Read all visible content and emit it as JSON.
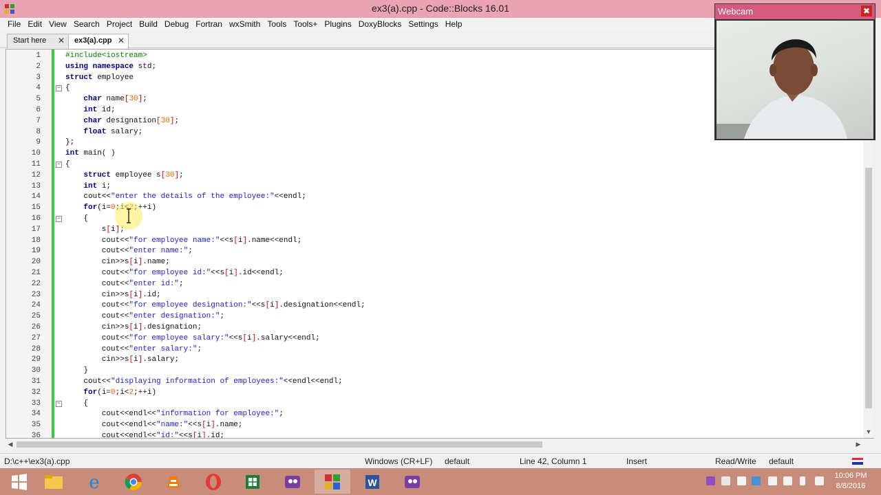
{
  "window": {
    "title": "ex3(a).cpp - Code::Blocks 16.01"
  },
  "menu": [
    "File",
    "Edit",
    "View",
    "Search",
    "Project",
    "Build",
    "Debug",
    "Fortran",
    "wxSmith",
    "Tools",
    "Tools+",
    "Plugins",
    "DoxyBlocks",
    "Settings",
    "Help"
  ],
  "tabs": [
    {
      "label": "Start here",
      "active": false
    },
    {
      "label": "ex3(a).cpp",
      "active": true
    }
  ],
  "editor": {
    "lines": [
      {
        "n": "1",
        "text": "#include<iostream>"
      },
      {
        "n": "2",
        "text": "using namespace std;"
      },
      {
        "n": "3",
        "text": "struct employee"
      },
      {
        "n": "4",
        "text": "{"
      },
      {
        "n": "5",
        "text": "    char name[30];"
      },
      {
        "n": "6",
        "text": "    int id;"
      },
      {
        "n": "7",
        "text": "    char designation[30];"
      },
      {
        "n": "8",
        "text": "    float salary;"
      },
      {
        "n": "9",
        "text": "};"
      },
      {
        "n": "10",
        "text": "int main( )"
      },
      {
        "n": "11",
        "text": "{"
      },
      {
        "n": "12",
        "text": "    struct employee s[30];"
      },
      {
        "n": "13",
        "text": "    int i;"
      },
      {
        "n": "14",
        "text": "    cout<<\"enter the details of the employee:\"<<endl;"
      },
      {
        "n": "15",
        "text": "    for(i=0;i<2;++i)"
      },
      {
        "n": "16",
        "text": "    {"
      },
      {
        "n": "17",
        "text": "        s[i];"
      },
      {
        "n": "18",
        "text": "        cout<<\"for employee name:\"<<s[i].name<<endl;"
      },
      {
        "n": "19",
        "text": "        cout<<\"enter name:\";"
      },
      {
        "n": "20",
        "text": "        cin>>s[i].name;"
      },
      {
        "n": "21",
        "text": "        cout<<\"for employee id:\"<<s[i].id<<endl;"
      },
      {
        "n": "22",
        "text": "        cout<<\"enter id:\";"
      },
      {
        "n": "23",
        "text": "        cin>>s[i].id;"
      },
      {
        "n": "24",
        "text": "        cout<<\"for employee designation:\"<<s[i].designation<<endl;"
      },
      {
        "n": "25",
        "text": "        cout<<\"enter designation:\";"
      },
      {
        "n": "26",
        "text": "        cin>>s[i].designation;"
      },
      {
        "n": "27",
        "text": "        cout<<\"for employee salary:\"<<s[i].salary<<endl;"
      },
      {
        "n": "28",
        "text": "        cout<<\"enter salary:\";"
      },
      {
        "n": "29",
        "text": "        cin>>s[i].salary;"
      },
      {
        "n": "30",
        "text": "    }"
      },
      {
        "n": "31",
        "text": "    cout<<\"displaying information of employees:\"<<endl<<endl;"
      },
      {
        "n": "32",
        "text": "    for(i=0;i<2;++i)"
      },
      {
        "n": "33",
        "text": "    {"
      },
      {
        "n": "34",
        "text": "        cout<<endl<<\"information for employee:\";"
      },
      {
        "n": "35",
        "text": "        cout<<endl<<\"name:\"<<s[i].name;"
      },
      {
        "n": "36",
        "text": "        cout<<endl<<\"id:\"<<s[i].id;"
      }
    ],
    "fold_lines": [
      "4",
      "11",
      "16",
      "33"
    ]
  },
  "statusbar": {
    "path": "D:\\c++\\ex3(a).cpp",
    "eol": "Windows (CR+LF)",
    "encoding": "default",
    "position": "Line 42, Column 1",
    "mode": "Insert",
    "access": "Read/Write",
    "lang": "default"
  },
  "webcam": {
    "title": "Webcam",
    "close": "✖"
  },
  "taskbar": {
    "apps": [
      "start",
      "file-explorer",
      "internet-explorer",
      "chrome",
      "vlc",
      "opera",
      "excel",
      "screen-recorder",
      "codeblocks",
      "word",
      "screen-recorder-2"
    ],
    "clock_time": "10:06 PM",
    "clock_date": "8/8/2016"
  },
  "colors": {
    "titlebar": "#e9a3b3",
    "keyword": "#00008b",
    "preprocessor": "#008000",
    "string": "#2020e0",
    "number": "#f06000",
    "changebar": "#38d038",
    "taskbar": "#c78d7a"
  }
}
